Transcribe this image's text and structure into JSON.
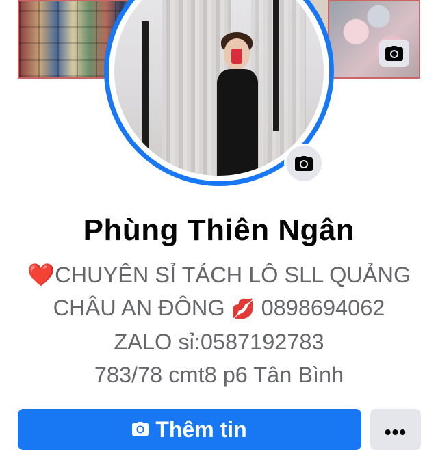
{
  "profile": {
    "name": "Phùng Thiên Ngân",
    "bio_lines": [
      {
        "prefix": "❤️",
        "text": "CHUYÊN SỈ TÁCH LÔ SLL QUẢNG"
      },
      {
        "text_before": "CHÂU AN ĐÔNG ",
        "emoji": "💋",
        "text_after": " 0898694062"
      },
      {
        "text": "ZALO sỉ:0587192783"
      },
      {
        "text": "783/78 cmt8 p6 Tân Bình"
      }
    ]
  },
  "buttons": {
    "primary_label": "Thêm tin",
    "more_label": "•••"
  },
  "icons": {
    "cover_camera": "camera-icon",
    "avatar_camera": "camera-icon",
    "primary_button": "camera-icon"
  },
  "colors": {
    "accent": "#1877f2",
    "secondary_button": "#e4e6eb",
    "bio_text": "#65676b"
  }
}
